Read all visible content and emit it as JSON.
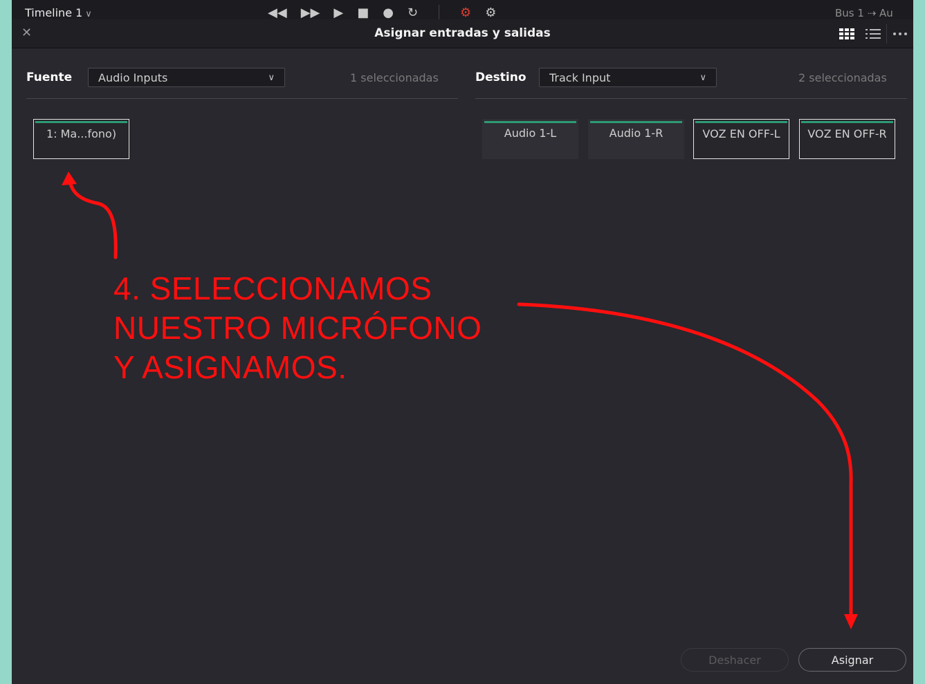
{
  "top_strip": {
    "timeline": "Timeline 1",
    "bus": "Bus 1  ⇢  Au"
  },
  "dialog": {
    "title": "Asignar entradas y salidas"
  },
  "source": {
    "label": "Fuente",
    "dropdown_value": "Audio Inputs",
    "selected_count": "1 seleccionadas",
    "items": [
      {
        "label": "1: Ma...fono)",
        "selected": true
      }
    ]
  },
  "destination": {
    "label": "Destino",
    "dropdown_value": "Track Input",
    "selected_count": "2 seleccionadas",
    "items": [
      {
        "label": "Audio 1-L",
        "selected": false
      },
      {
        "label": "Audio 1-R",
        "selected": false
      },
      {
        "label": "VOZ EN OFF-L",
        "selected": true
      },
      {
        "label": "VOZ EN OFF-R",
        "selected": true
      }
    ]
  },
  "footer": {
    "undo_label": "Deshacer",
    "assign_label": "Asignar"
  },
  "annotation": {
    "text": "4. SELECCIONAMOS\nNUESTRO MICRÓFONO\nY ASIGNAMOS."
  },
  "colors": {
    "accent_green": "#2e9b73",
    "annotation_red": "#ff0f0f",
    "frame_teal": "#94d8c9"
  }
}
